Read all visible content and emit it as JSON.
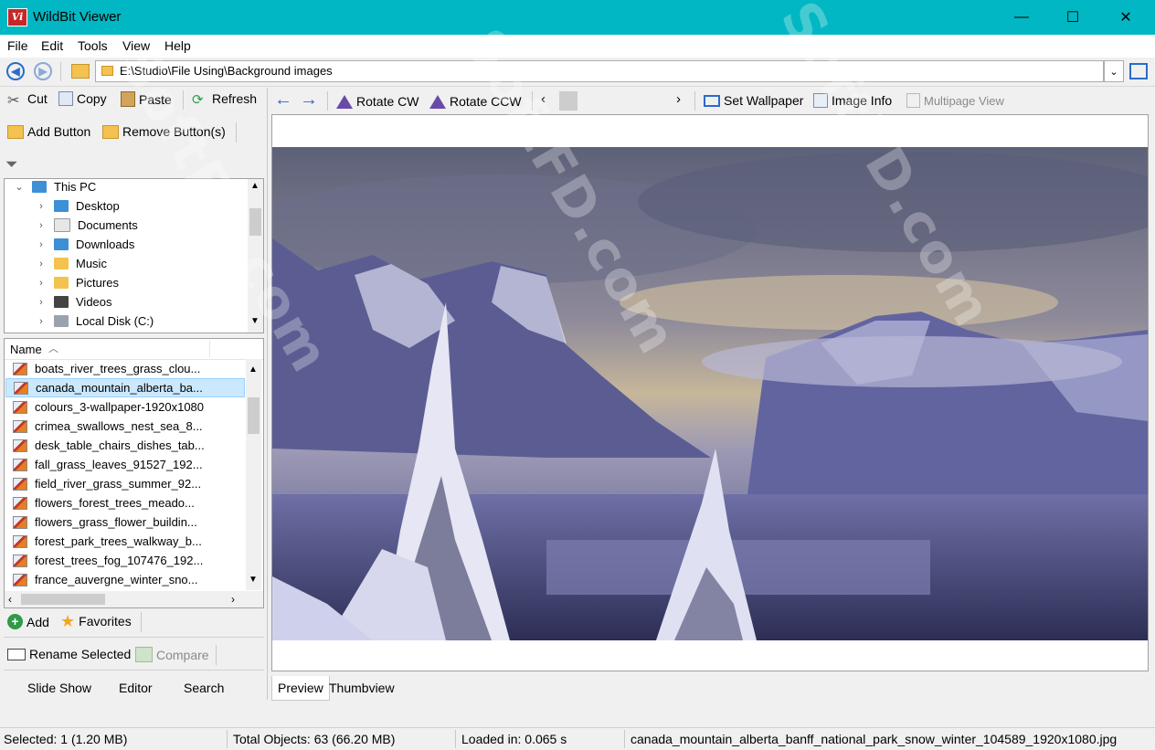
{
  "window": {
    "title": "WildBit Viewer",
    "icon_text": "Vi",
    "minimize": "—",
    "maximize": "☐",
    "close": "✕"
  },
  "menu": [
    "File",
    "Edit",
    "Tools",
    "View",
    "Help"
  ],
  "address": {
    "path": "E:\\Studio\\File Using\\Background images"
  },
  "left_toolbar": {
    "cut": "Cut",
    "copy": "Copy",
    "paste": "Paste",
    "refresh": "Refresh",
    "add_button": "Add Button",
    "remove_button": "Remove Button(s)"
  },
  "tree": {
    "root": "This PC",
    "items": [
      "Desktop",
      "Documents",
      "Downloads",
      "Music",
      "Pictures",
      "Videos",
      "Local Disk (C:)"
    ]
  },
  "filelist": {
    "column_name": "Name",
    "files": [
      "boats_river_trees_grass_clou...",
      "canada_mountain_alberta_ba...",
      "colours_3-wallpaper-1920x1080",
      "crimea_swallows_nest_sea_8...",
      "desk_table_chairs_dishes_tab...",
      "fall_grass_leaves_91527_192...",
      "field_river_grass_summer_92...",
      "flowers_forest_trees_meado...",
      "flowers_grass_flower_buildin...",
      "forest_park_trees_walkway_b...",
      "forest_trees_fog_107476_192...",
      "france_auvergne_winter_sno..."
    ],
    "selected_index": 1
  },
  "left_bottom": {
    "add": "Add",
    "favorites": "Favorites",
    "rename_selected": "Rename Selected",
    "compare": "Compare",
    "slide_show": "Slide Show",
    "editor": "Editor",
    "search": "Search"
  },
  "viewer_toolbar": {
    "rotate_cw": "Rotate CW",
    "rotate_ccw": "Rotate CCW",
    "set_wallpaper": "Set Wallpaper",
    "image_info": "Image Info",
    "multipage_view": "Multipage View"
  },
  "viewer_tabs": {
    "preview": "Preview",
    "thumbview": "Thumbview"
  },
  "status": {
    "selected": "Selected: 1 (1.20 MB)",
    "total": "Total Objects: 63 (66.20 MB)",
    "loaded": "Loaded in: 0.065 s",
    "filename": "canada_mountain_alberta_banff_national_park_snow_winter_104589_1920x1080.jpg"
  },
  "watermark": "SoftFD.com",
  "colors": {
    "titlebar": "#00b7c3",
    "selection": "#cce8ff",
    "accent_blue": "#2a6cc9"
  }
}
